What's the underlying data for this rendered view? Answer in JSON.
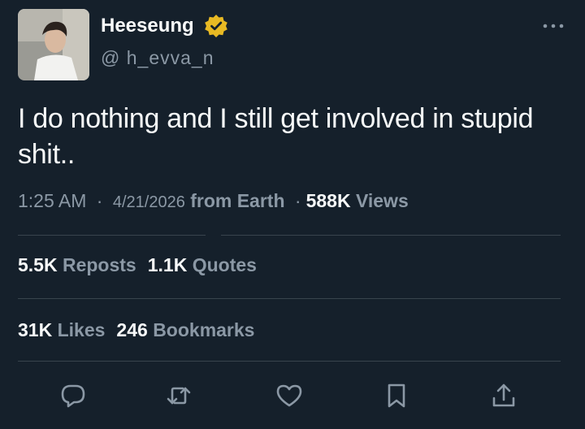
{
  "user": {
    "display_name": "Heeseung",
    "handle": "@ h_evva_n",
    "verified_color": "#e8b923"
  },
  "tweet": {
    "text": "I do nothing and I still get involved in stupid shit.."
  },
  "meta": {
    "time": "1:25 AM",
    "separator": "·",
    "date": "4/21/2026",
    "location": "from Earth",
    "views_count": "588K",
    "views_label": "Views"
  },
  "stats": {
    "reposts_count": "5.5K",
    "reposts_label": "Reposts",
    "quotes_count": "1.1K",
    "quotes_label": "Quotes",
    "likes_count": "31K",
    "likes_label": "Likes",
    "bookmarks_count": "246",
    "bookmarks_label": "Bookmarks"
  },
  "actions": {
    "reply_icon": "reply-icon",
    "repost_icon": "repost-icon",
    "like_icon": "heart-icon",
    "bookmark_icon": "bookmark-icon",
    "share_icon": "share-icon"
  },
  "colors": {
    "background": "#15202b",
    "primary_text": "#f7f9f9",
    "secondary_text": "#8b98a5",
    "divider": "#38444d"
  }
}
